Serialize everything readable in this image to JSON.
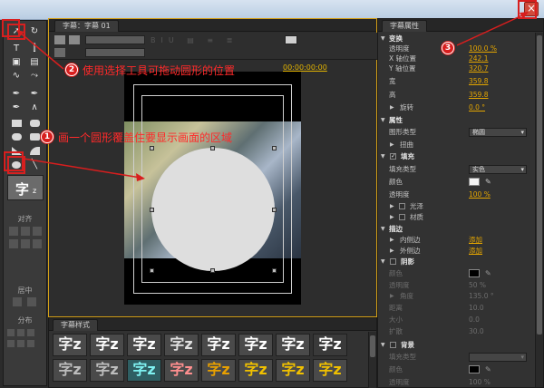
{
  "canvas_panel": {
    "tab_label": "字幕：字幕 01",
    "timecode": "00:00:00:00"
  },
  "tools_panel": {
    "align_label": "对齐",
    "center_label": "居中",
    "distribute_label": "分布",
    "style_preview_text": "字"
  },
  "styles_panel": {
    "tab_label": "字幕样式",
    "swatch_text": "字z"
  },
  "props_panel": {
    "tab_label": "字幕属性",
    "transform": {
      "title": "变换",
      "opacity": {
        "label": "透明度",
        "value": "100.0 %"
      },
      "x": {
        "label": "X 轴位置",
        "value": "242.1"
      },
      "y": {
        "label": "Y 轴位置",
        "value": "320.7"
      },
      "width": {
        "label": "宽",
        "value": "359.8"
      },
      "height": {
        "label": "高",
        "value": "359.8"
      },
      "rotation": {
        "label": "旋转",
        "value": "0.0 °"
      }
    },
    "properties": {
      "title": "属性",
      "shape_type": {
        "label": "图形类型",
        "value": "椭圆"
      },
      "distort": {
        "label": "扭曲"
      }
    },
    "fill": {
      "title": "填充",
      "fill_type": {
        "label": "填充类型",
        "value": "实色"
      },
      "color": {
        "label": "颜色",
        "hex": "#f4f4f4"
      },
      "opacity": {
        "label": "透明度",
        "value": "100 %"
      },
      "sheen": {
        "label": "光泽"
      },
      "texture": {
        "label": "材质"
      }
    },
    "stroke": {
      "title": "描边",
      "inner": {
        "label": "内侧边",
        "value": "添加"
      },
      "outer": {
        "label": "外侧边",
        "value": "添加"
      }
    },
    "shadow": {
      "title": "阴影",
      "color": {
        "label": "颜色",
        "hex": "#000000"
      },
      "opacity": {
        "label": "透明度",
        "value": "50 %"
      },
      "angle": {
        "label": "角度",
        "value": "135.0 °"
      },
      "distance": {
        "label": "距离",
        "value": "10.0"
      },
      "size": {
        "label": "大小",
        "value": "0.0"
      },
      "spread": {
        "label": "扩散",
        "value": "30.0"
      }
    },
    "background": {
      "title": "背景",
      "fill_type": {
        "label": "填充类型"
      },
      "color": {
        "label": "颜色",
        "hex": "#000000"
      },
      "opacity": {
        "label": "透明度",
        "value": "100 %"
      }
    }
  },
  "annotations": [
    {
      "number": "1",
      "text": "画一个圆形覆盖住要显示画面的区域"
    },
    {
      "number": "2",
      "text": "使用选择工具可拖动圆形的位置"
    },
    {
      "number": "3",
      "text": ""
    }
  ],
  "colors": {
    "accent_orange": "#e5a600",
    "annotation_red": "#d81e1e",
    "panel_bg": "#323232"
  }
}
